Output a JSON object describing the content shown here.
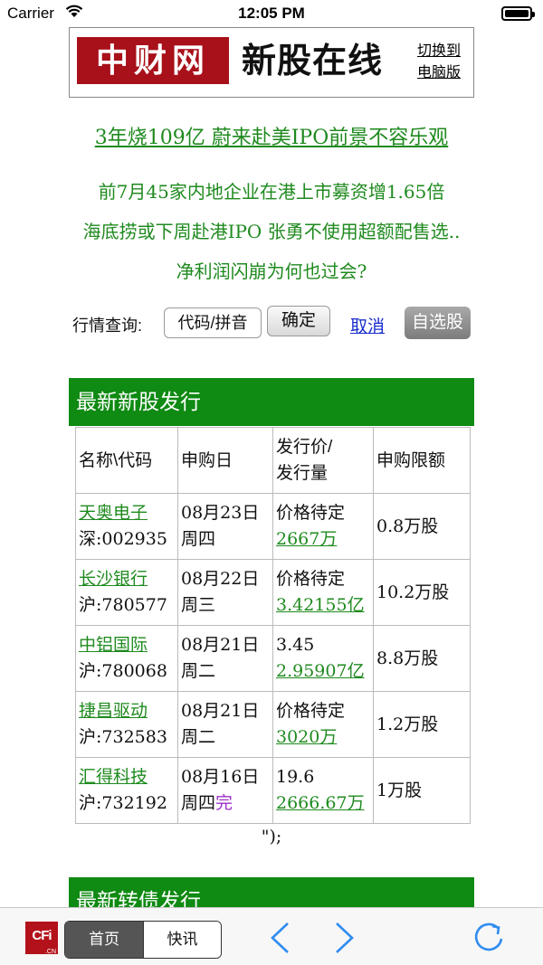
{
  "status": {
    "carrier": "Carrier",
    "time": "12:05 PM"
  },
  "banner": {
    "logo_cn": "中财网",
    "logo_text": "新股在线",
    "switch_line1": "切换到",
    "switch_line2": "电脑版"
  },
  "news": {
    "headline": "3年烧109亿 蔚来赴美IPO前景不容乐观",
    "items": [
      "前7月45家内地企业在港上市募资增1.65倍",
      "海底捞或下周赴港IPO 张勇不使用超额配售选..",
      "净利润闪崩为何也过会?"
    ]
  },
  "query": {
    "label": "行情查询:",
    "placeholder": "代码/拼音",
    "ok": "确定",
    "cancel": "取消",
    "favorites": "自选股"
  },
  "section_ipo": {
    "title": "最新新股发行",
    "headers": [
      "名称\\代码",
      "申购日",
      "发行价/",
      "发行量",
      "申购限额"
    ],
    "rows": [
      {
        "name": "天奥电子",
        "code": "深:002935",
        "date": "08月23日",
        "weekday": "周四",
        "price": "价格待定",
        "volume": "2667万",
        "limit": "0.8万股",
        "status": ""
      },
      {
        "name": "长沙银行",
        "code": "沪:780577",
        "date": "08月22日",
        "weekday": "周三",
        "price": "价格待定",
        "volume": "3.42155亿",
        "limit": "10.2万股",
        "status": ""
      },
      {
        "name": "中铝国际",
        "code": "沪:780068",
        "date": "08月21日",
        "weekday": "周二",
        "price": "3.45",
        "volume": "2.95907亿",
        "limit": "8.8万股",
        "status": ""
      },
      {
        "name": "捷昌驱动",
        "code": "沪:732583",
        "date": "08月21日",
        "weekday": "周二",
        "price": "价格待定",
        "volume": "3020万",
        "limit": "1.2万股",
        "status": ""
      },
      {
        "name": "汇得科技",
        "code": "沪:732192",
        "date": "08月16日",
        "weekday": "周四",
        "price": "19.6",
        "volume": "2666.67万",
        "limit": "1万股",
        "status": "完"
      }
    ],
    "trailing": "\");"
  },
  "section_bond": {
    "title": "最新转债发行"
  },
  "toolbar": {
    "logo": "CFi",
    "logo_sub": ".CN",
    "home": "首页",
    "news": "快讯"
  },
  "colors": {
    "accent_green": "#0f8a12",
    "link_green": "#1f8a1f",
    "logo_red": "#a8101a"
  }
}
